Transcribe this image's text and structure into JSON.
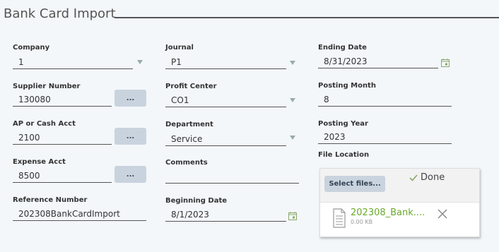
{
  "header": {
    "title": "Bank Card Import"
  },
  "company": {
    "label": "Company",
    "value": "1"
  },
  "supplier_number": {
    "label": "Supplier Number",
    "value": "130080",
    "lookup_label": "..."
  },
  "ap_cash_acct": {
    "label": "AP or Cash Acct",
    "value": "2100",
    "lookup_label": "..."
  },
  "expense_acct": {
    "label": "Expense Acct",
    "value": "8500",
    "lookup_label": "..."
  },
  "reference_number": {
    "label": "Reference Number",
    "value": "202308BankCardImport"
  },
  "journal": {
    "label": "Journal",
    "value": "P1"
  },
  "profit_center": {
    "label": "Profit Center",
    "value": "CO1"
  },
  "department": {
    "label": "Department",
    "value": "Service"
  },
  "comments": {
    "label": "Comments",
    "value": ""
  },
  "beginning_date": {
    "label": "Beginning Date",
    "value": "8/1/2023"
  },
  "ending_date": {
    "label": "Ending Date",
    "value": "8/31/2023"
  },
  "posting_month": {
    "label": "Posting Month",
    "value": "8"
  },
  "posting_year": {
    "label": "Posting Year",
    "value": "2023"
  },
  "file_location": {
    "label": "File Location",
    "select_button": "Select files...",
    "done_label": "Done",
    "file": {
      "name": "202308_Bank....",
      "size": "0.00 KB"
    }
  },
  "colors": {
    "accent_green": "#6aaa2a",
    "button_bg": "#c9d3de",
    "page_bg": "#f3f7fa"
  }
}
